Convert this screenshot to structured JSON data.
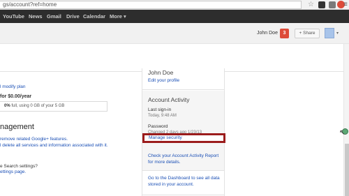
{
  "browser": {
    "url": "gs/account?ref=home",
    "icons": [
      "star-icon",
      "extension-icon",
      "extension-icon-2",
      "ext-red-icon",
      "menu-icon"
    ]
  },
  "gbar": {
    "links": [
      "YouTube",
      "News",
      "Gmail",
      "Drive",
      "Calendar",
      "More ▾"
    ]
  },
  "header": {
    "user_name": "John Doe",
    "notification_count": "3",
    "share_label": "+ Share"
  },
  "left": {
    "modify_plan": "l modify plan",
    "price_line": "for $0.00/year",
    "storage_pct": "0%",
    "storage_text": " full, using 0 GB of your 5 GB",
    "heading": "nagement",
    "remove_link": "remove related Google+ features.",
    "delete_link": "l delete all services and information associated with it.",
    "search_q": "e Search settings?",
    "settings_link": "ettings page."
  },
  "panel": {
    "name": "John Doe",
    "edit_profile": "Edit your profile",
    "activity_title": "Account Activity",
    "last_signin_label": "Last sign-in",
    "last_signin_value": "Today, 9:48 AM",
    "password_label": "Password",
    "password_changed": "Changed 2 days ago 1/23/13",
    "manage_security": "Manage security",
    "report_text": "Check your Account Activity Report for more details.",
    "dashboard_text": "Go to the Dashboard to see all data stored in your account."
  },
  "colors": {
    "gbar_bg": "#2d2d2d",
    "link": "#1a4fb5",
    "notification": "#dd4b39",
    "highlight_border": "#9b1c1c"
  }
}
